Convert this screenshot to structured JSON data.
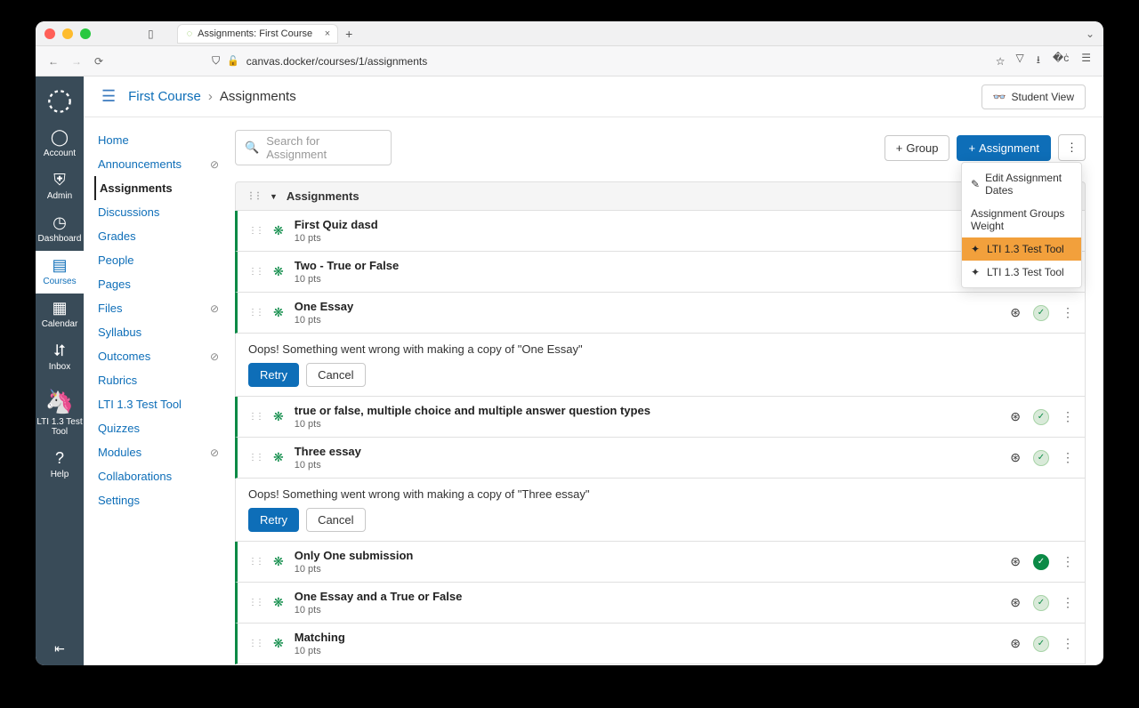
{
  "browser": {
    "tab_title": "Assignments: First Course",
    "url": "canvas.docker/courses/1/assignments"
  },
  "global_nav": [
    {
      "icon": "account",
      "label": "Account"
    },
    {
      "icon": "admin",
      "label": "Admin"
    },
    {
      "icon": "dashboard",
      "label": "Dashboard"
    },
    {
      "icon": "courses",
      "label": "Courses",
      "active": true
    },
    {
      "icon": "calendar",
      "label": "Calendar"
    },
    {
      "icon": "inbox",
      "label": "Inbox"
    },
    {
      "icon": "lti",
      "label": "LTI 1.3 Test Tool"
    },
    {
      "icon": "help",
      "label": "Help"
    }
  ],
  "breadcrumb": {
    "course": "First Course",
    "page": "Assignments"
  },
  "student_view": "Student View",
  "course_nav": [
    {
      "label": "Home"
    },
    {
      "label": "Announcements",
      "hidden": true
    },
    {
      "label": "Assignments",
      "active": true
    },
    {
      "label": "Discussions"
    },
    {
      "label": "Grades"
    },
    {
      "label": "People"
    },
    {
      "label": "Pages"
    },
    {
      "label": "Files",
      "hidden": true
    },
    {
      "label": "Syllabus"
    },
    {
      "label": "Outcomes",
      "hidden": true
    },
    {
      "label": "Rubrics"
    },
    {
      "label": "LTI 1.3 Test Tool"
    },
    {
      "label": "Quizzes"
    },
    {
      "label": "Modules",
      "hidden": true
    },
    {
      "label": "Collaborations"
    },
    {
      "label": "Settings"
    }
  ],
  "search_placeholder": "Search for Assignment",
  "buttons": {
    "group": "Group",
    "assignment": "Assignment",
    "retry": "Retry",
    "cancel": "Cancel"
  },
  "group_title": "Assignments",
  "assignments": [
    {
      "title": "First Quiz dasd",
      "pts": "10 pts",
      "status": null
    },
    {
      "title": "Two - True or False",
      "pts": "10 pts",
      "status": "check"
    },
    {
      "title": "One Essay",
      "pts": "10 pts",
      "status": "check"
    }
  ],
  "error1": "Oops! Something went wrong with making a copy of \"One Essay\"",
  "assignments2": [
    {
      "title": "true or false, multiple choice and multiple answer question types",
      "pts": "10 pts",
      "status": "check"
    },
    {
      "title": "Three essay",
      "pts": "10 pts",
      "status": "check"
    }
  ],
  "error2": "Oops! Something went wrong with making a copy of \"Three essay\"",
  "assignments3": [
    {
      "title": "Only One submission",
      "pts": "10 pts",
      "status": "solid"
    },
    {
      "title": "One Essay and a True or False",
      "pts": "10 pts",
      "status": "check"
    },
    {
      "title": "Matching",
      "pts": "10 pts",
      "status": "check"
    }
  ],
  "dropdown": [
    {
      "label": "Edit Assignment Dates",
      "icon": "pencil"
    },
    {
      "label": "Assignment Groups Weight",
      "icon": ""
    },
    {
      "label": "LTI 1.3 Test Tool",
      "icon": "tool",
      "hover": true
    },
    {
      "label": "LTI 1.3 Test Tool",
      "icon": "tool"
    }
  ]
}
